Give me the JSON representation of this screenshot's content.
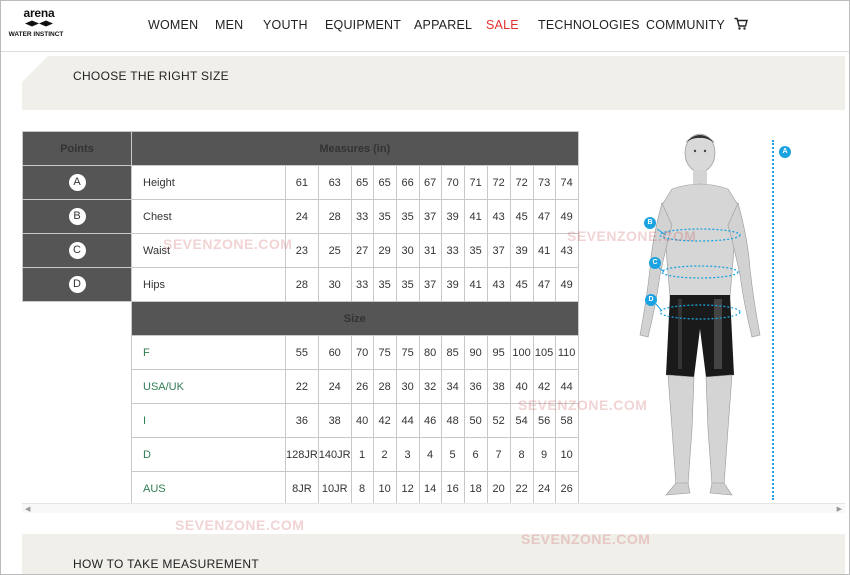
{
  "brand": {
    "name": "arena",
    "tagline": "WATER INSTINCT"
  },
  "nav": {
    "women": "WOMEN",
    "men": "MEN",
    "youth": "YOUTH",
    "equipment": "EQUIPMENT",
    "apparel": "APPAREL",
    "sale": "SALE",
    "technologies": "TECHNOLOGIES",
    "community": "COMMUNITY",
    "cart_icon": "cart-icon"
  },
  "colors": {
    "sale": "#e2302c",
    "header_cell": "#555555",
    "band": "#f0efea",
    "marker": "#1aa3e0",
    "size_label": "#2e7d52"
  },
  "sections": {
    "choose_size": "CHOOSE THE RIGHT SIZE",
    "how_to_measure": "HOW TO TAKE MEASUREMENT"
  },
  "table": {
    "points_header": "Points",
    "measures_header": "Measures (in)",
    "size_header": "Size",
    "measures": [
      {
        "point": "A",
        "label": "Height",
        "values": [
          "61",
          "63",
          "65",
          "65",
          "66",
          "67",
          "70",
          "71",
          "72",
          "72",
          "73",
          "74"
        ]
      },
      {
        "point": "B",
        "label": "Chest",
        "values": [
          "24",
          "28",
          "33",
          "35",
          "35",
          "37",
          "39",
          "41",
          "43",
          "45",
          "47",
          "49"
        ]
      },
      {
        "point": "C",
        "label": "Waist",
        "values": [
          "23",
          "25",
          "27",
          "29",
          "30",
          "31",
          "33",
          "35",
          "37",
          "39",
          "41",
          "43"
        ]
      },
      {
        "point": "D",
        "label": "Hips",
        "values": [
          "28",
          "30",
          "33",
          "35",
          "35",
          "37",
          "39",
          "41",
          "43",
          "45",
          "47",
          "49"
        ]
      }
    ],
    "sizes": [
      {
        "label": "F",
        "values": [
          "55",
          "60",
          "70",
          "75",
          "75",
          "80",
          "85",
          "90",
          "95",
          "100",
          "105",
          "110"
        ]
      },
      {
        "label": "USA/UK",
        "values": [
          "22",
          "24",
          "26",
          "28",
          "30",
          "32",
          "34",
          "36",
          "38",
          "40",
          "42",
          "44"
        ]
      },
      {
        "label": "I",
        "values": [
          "36",
          "38",
          "40",
          "42",
          "44",
          "46",
          "48",
          "50",
          "52",
          "54",
          "56",
          "58"
        ]
      },
      {
        "label": "D",
        "values": [
          "128JR",
          "140JR",
          "1",
          "2",
          "3",
          "4",
          "5",
          "6",
          "7",
          "8",
          "9",
          "10"
        ]
      },
      {
        "label": "AUS",
        "values": [
          "8JR",
          "10JR",
          "8",
          "10",
          "12",
          "14",
          "16",
          "18",
          "20",
          "22",
          "24",
          "26"
        ]
      }
    ]
  },
  "figure": {
    "markers": {
      "a": "A",
      "b": "B",
      "c": "C",
      "d": "D"
    }
  },
  "watermark": "SEVENZONE.COM"
}
